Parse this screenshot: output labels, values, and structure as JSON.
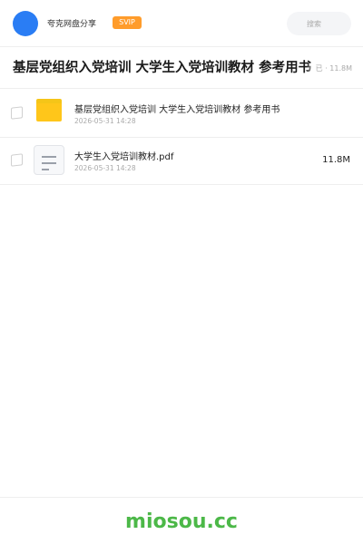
{
  "header": {
    "brand_label": "夸克网盘分享",
    "badge_label": "SVIP",
    "search_placeholder": "搜索"
  },
  "title_bar": {
    "title": "基层党组织入党培训 大学生入党培训教材 参考用书",
    "meta": "已 · 11.8M"
  },
  "files": [
    {
      "name": "基层党组织入党培训 大学生入党培训教材 参考用书",
      "date": "2026-05-31 14:28",
      "size": "",
      "icon": "folder-icon"
    },
    {
      "name": "大学生入党培训教材.pdf",
      "date": "2026-05-31 14:28",
      "size": "11.8M",
      "icon": "file-icon"
    }
  ],
  "footer": {
    "site": "miosou.cc"
  },
  "colors": {
    "accent": "#2a7df4",
    "badge": "#ff9c2b",
    "folder": "#ffc61a",
    "site_text": "#4cb848"
  }
}
